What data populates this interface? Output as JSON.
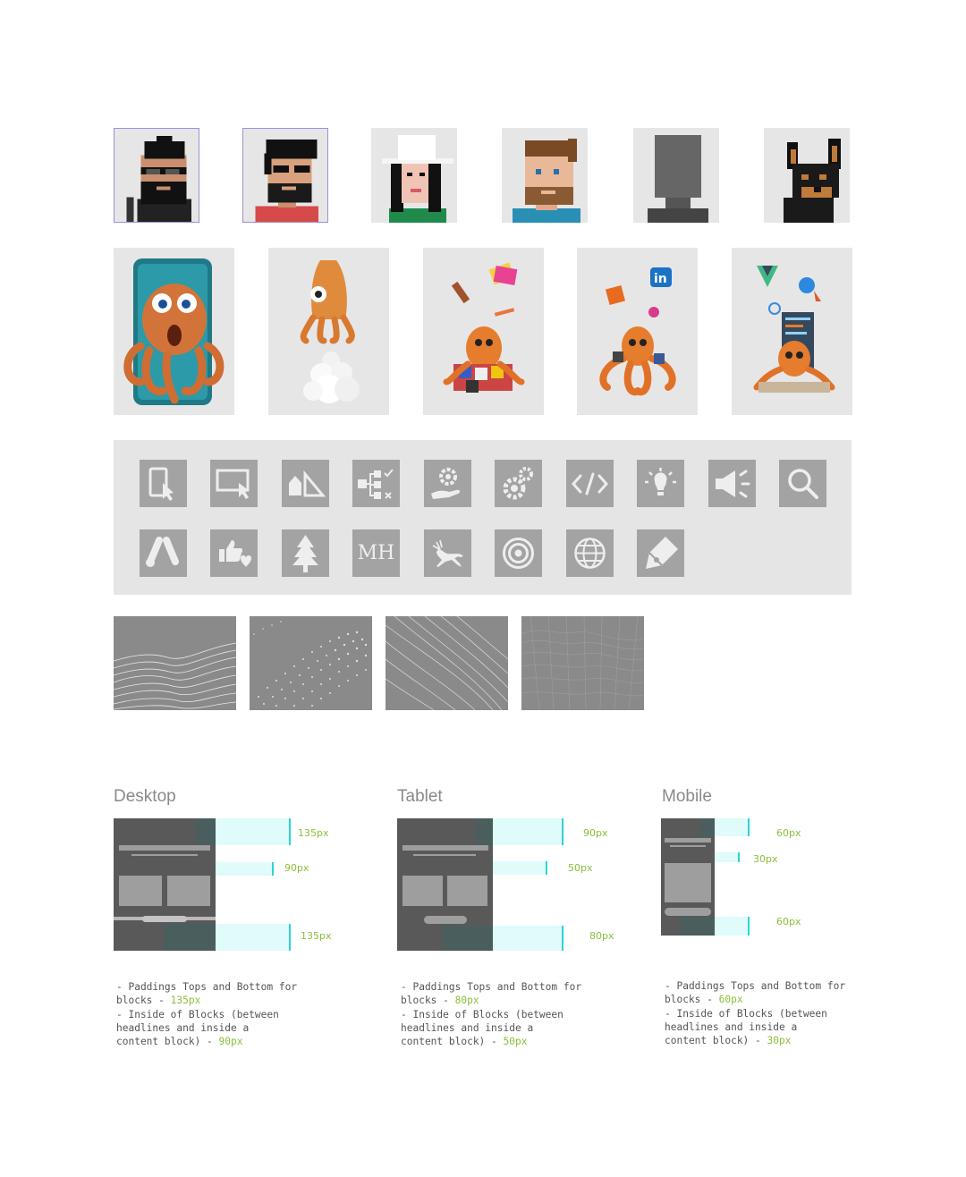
{
  "avatars": [
    {
      "name": "bearded-man-sunglasses"
    },
    {
      "name": "man-sunglasses-red-shirt"
    },
    {
      "name": "woman-white-hat"
    },
    {
      "name": "man-brown-hair"
    },
    {
      "name": "placeholder-silhouette"
    },
    {
      "name": "doberman-dog"
    }
  ],
  "octopus_cards": [
    {
      "name": "octopus-smartphone"
    },
    {
      "name": "octopus-rocket"
    },
    {
      "name": "octopus-design-tools"
    },
    {
      "name": "octopus-social-media"
    },
    {
      "name": "octopus-web-development"
    }
  ],
  "icons_row1": [
    "mobile-click-icon",
    "desktop-click-icon",
    "shapes-icon",
    "sitemap-icon",
    "hand-gear-icon",
    "gears-icon",
    "code-icon",
    "lightbulb-icon",
    "megaphone-icon",
    "search-icon"
  ],
  "icons_row2": [
    "google-ads-icon",
    "thumbs-up-heart-icon",
    "tree-icon",
    "mh-monogram-icon",
    "deer-icon",
    "target-icon",
    "globe-icon",
    "pen-icon"
  ],
  "monogram": "MH",
  "textures": [
    {
      "name": "wave-lines-texture"
    },
    {
      "name": "dot-grid-texture"
    },
    {
      "name": "diagonal-lines-texture"
    },
    {
      "name": "mesh-terrain-texture"
    }
  ],
  "spacing": {
    "desktop": {
      "title": "Desktop",
      "guides": [
        "135px",
        "90px",
        "135px"
      ],
      "note_line1": "- Paddings Tops and Bottom for",
      "note_line2": "blocks - ",
      "note_value_blocks": "135px",
      "note_line3": "- Inside of Blocks (between",
      "note_line4": "headlines and inside a",
      "note_line5": "content block) - ",
      "note_value_inside": "90px"
    },
    "tablet": {
      "title": "Tablet",
      "guides": [
        "90px",
        "50px",
        "80px"
      ],
      "note_line1": "- Paddings Tops and Bottom for",
      "note_line2": "blocks - ",
      "note_value_blocks": "80px",
      "note_line3": "- Inside of Blocks (between",
      "note_line4": "headlines and inside a",
      "note_line5": "content block) - ",
      "note_value_inside": "50px"
    },
    "mobile": {
      "title": "Mobile",
      "guides": [
        "60px",
        "30px",
        "60px"
      ],
      "note_line1": "- Paddings Tops and Bottom for",
      "note_line2": "blocks - ",
      "note_value_blocks": "60px",
      "note_line3": "- Inside of Blocks (between",
      "note_line4": "headlines and inside a",
      "note_line5": "content block) - ",
      "note_value_inside": "30px"
    }
  },
  "colors": {
    "tile_bg": "#e6e6e6",
    "icon_tile": "#a3a3a3",
    "frame_dark": "#585858",
    "frame_teal": "#4a5e5d",
    "guide_cyan": "#dffbfa",
    "guide_line": "#2ed3d6",
    "px_green": "#8bbf3a",
    "selection_border": "#9f8fd8"
  }
}
